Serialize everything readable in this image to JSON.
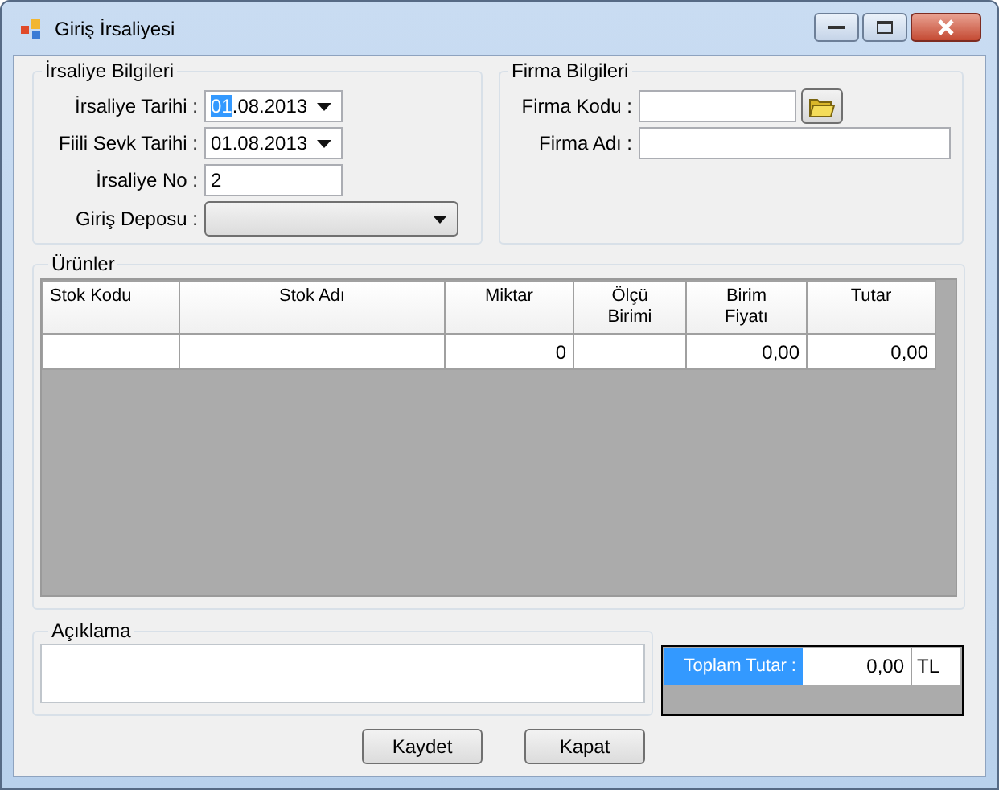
{
  "window": {
    "title": "Giriş İrsaliyesi"
  },
  "irsaliye_bilgileri": {
    "title": "İrsaliye Bilgileri",
    "fields": [
      {
        "label": "İrsaliye Tarihi :",
        "kind": "date",
        "value": "01.08.2013",
        "focused": true
      },
      {
        "label": "Fiili Sevk Tarihi :",
        "kind": "date",
        "value": "01.08.2013",
        "focused": false
      },
      {
        "label": "İrsaliye No :",
        "kind": "text",
        "value": "2"
      },
      {
        "label": "Giriş Deposu :",
        "kind": "combo"
      }
    ]
  },
  "firma_bilgileri": {
    "title": "Firma Bilgileri",
    "fields": [
      {
        "label": "Firma Kodu :",
        "kind": "lookup"
      },
      {
        "label": "Firma Adı :",
        "kind": "text"
      }
    ]
  },
  "urunler": {
    "title": "Ürünler",
    "table": {
      "columns": [
        {
          "label": "Stok Kodu"
        },
        {
          "label": "Stok Adı"
        },
        {
          "label": "Miktar"
        },
        {
          "label": "Ölçü Birimi"
        },
        {
          "label": "Birim Fiyatı"
        },
        {
          "label": "Tutar"
        }
      ],
      "rows": [
        {
          "cells": [
            null,
            null,
            "0",
            null,
            "0,00",
            "0,00"
          ]
        }
      ]
    }
  },
  "aciklama": {
    "title": "Açıklama"
  },
  "toplam": {
    "label": "Toplam Tutar :",
    "value": "0,00",
    "unit": "TL"
  },
  "buttons": [
    "Kaydet",
    "Kapat"
  ]
}
